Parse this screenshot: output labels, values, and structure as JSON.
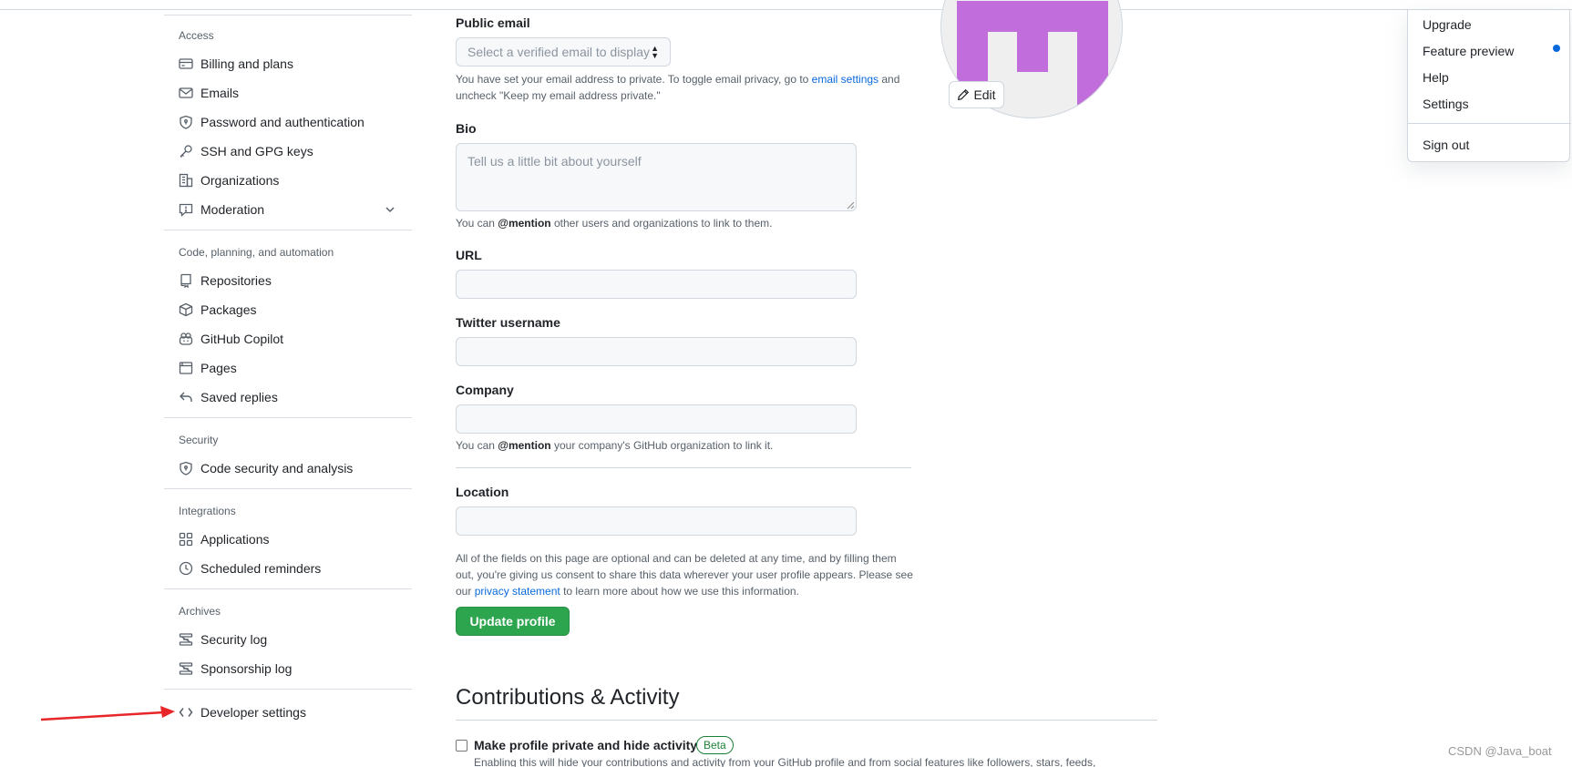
{
  "sidebar": {
    "groups": [
      {
        "heading": "Access"
      },
      {
        "heading": "Code, planning, and automation"
      },
      {
        "heading": "Security"
      },
      {
        "heading": "Integrations"
      },
      {
        "heading": "Archives"
      }
    ],
    "items": [
      {
        "label": "Billing and plans",
        "icon": "credit-card-icon"
      },
      {
        "label": "Emails",
        "icon": "mail-icon"
      },
      {
        "label": "Password and authentication",
        "icon": "shield-lock-icon"
      },
      {
        "label": "SSH and GPG keys",
        "icon": "key-icon"
      },
      {
        "label": "Organizations",
        "icon": "organization-icon"
      },
      {
        "label": "Moderation",
        "icon": "report-icon"
      },
      {
        "label": "Repositories",
        "icon": "repo-icon"
      },
      {
        "label": "Packages",
        "icon": "package-icon"
      },
      {
        "label": "GitHub Copilot",
        "icon": "copilot-icon"
      },
      {
        "label": "Pages",
        "icon": "browser-icon"
      },
      {
        "label": "Saved replies",
        "icon": "reply-icon"
      },
      {
        "label": "Code security and analysis",
        "icon": "shield-lock-icon"
      },
      {
        "label": "Applications",
        "icon": "apps-icon"
      },
      {
        "label": "Scheduled reminders",
        "icon": "clock-icon"
      },
      {
        "label": "Security log",
        "icon": "log-icon"
      },
      {
        "label": "Sponsorship log",
        "icon": "log-icon"
      },
      {
        "label": "Developer settings",
        "icon": "code-icon"
      }
    ]
  },
  "form": {
    "public_email": {
      "label": "Public email",
      "placeholder": "Select a verified email to display",
      "help_before": "You have set your email address to private. To toggle email privacy, go to ",
      "help_link": "email settings",
      "help_after_1": " and",
      "help_after_2": "uncheck \"Keep my email address private.\""
    },
    "bio": {
      "label": "Bio",
      "placeholder": "Tell us a little bit about yourself",
      "help_before": "You can ",
      "help_bold": "@mention",
      "help_after": " other users and organizations to link to them."
    },
    "url": {
      "label": "URL",
      "value": ""
    },
    "twitter": {
      "label": "Twitter username",
      "value": ""
    },
    "company": {
      "label": "Company",
      "value": "",
      "help_before": "You can ",
      "help_bold": "@mention",
      "help_after": " your company's GitHub organization to link it."
    },
    "location": {
      "label": "Location",
      "value": ""
    },
    "footer_line1": "All of the fields on this page are optional and can be deleted at any time, and by filling them",
    "footer_line2": "out, you're giving us consent to share this data wherever your user profile appears. Please see",
    "footer_line3_before": "our ",
    "footer_link": "privacy statement",
    "footer_line3_after": " to learn more about how we use this information.",
    "submit_label": "Update profile"
  },
  "avatar": {
    "edit_label": "Edit",
    "color": "#c16ddb"
  },
  "contributions": {
    "title": "Contributions & Activity",
    "private_label": "Make profile private and hide activity",
    "beta_label": "Beta",
    "private_desc": "Enabling this will hide your contributions and activity from your GitHub profile and from social features like followers, stars, feeds,"
  },
  "menu": {
    "items": [
      "Upgrade",
      "Feature preview",
      "Help",
      "Settings"
    ],
    "sign_out": "Sign out"
  },
  "watermark": "CSDN @Java_boat",
  "colors": {
    "accent": "#0969da",
    "primary_button": "#2da44e",
    "arrow": "#e8262a",
    "beta": "#1a7f37"
  }
}
